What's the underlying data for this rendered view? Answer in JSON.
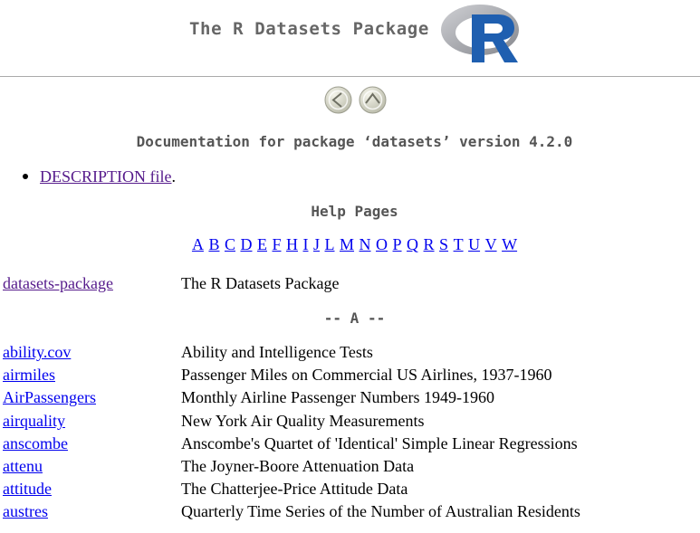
{
  "header": {
    "title": "The R Datasets Package",
    "logo_icon": "r-logo-icon"
  },
  "nav": {
    "back_icon": "arrow-left-icon",
    "up_icon": "arrow-up-icon"
  },
  "doc_heading": "Documentation for package ‘datasets’ version 4.2.0",
  "description_link": "DESCRIPTION file",
  "description_suffix": ".",
  "help_heading": "Help Pages",
  "letters": [
    "A",
    "B",
    "C",
    "D",
    "E",
    "F",
    "H",
    "I",
    "J",
    "L",
    "M",
    "N",
    "O",
    "P",
    "Q",
    "R",
    "S",
    "T",
    "U",
    "V",
    "W"
  ],
  "package_entry": {
    "topic": "datasets-package",
    "desc": "The R Datasets Package"
  },
  "section_a": "-- A --",
  "entries": [
    {
      "topic": "ability.cov",
      "desc": "Ability and Intelligence Tests"
    },
    {
      "topic": "airmiles",
      "desc": "Passenger Miles on Commercial US Airlines, 1937-1960"
    },
    {
      "topic": "AirPassengers",
      "desc": "Monthly Airline Passenger Numbers 1949-1960"
    },
    {
      "topic": "airquality",
      "desc": "New York Air Quality Measurements"
    },
    {
      "topic": "anscombe",
      "desc": "Anscombe's Quartet of 'Identical' Simple Linear Regressions"
    },
    {
      "topic": "attenu",
      "desc": "The Joyner-Boore Attenuation Data"
    },
    {
      "topic": "attitude",
      "desc": "The Chatterjee-Price Attitude Data"
    },
    {
      "topic": "austres",
      "desc": "Quarterly Time Series of the Number of Australian Residents"
    }
  ],
  "colors": {
    "link": "#0000ee",
    "visited_link": "#551a8b",
    "heading": "#555555",
    "r_blue": "#1f5fb0",
    "r_ring": "#9a9ca3"
  }
}
